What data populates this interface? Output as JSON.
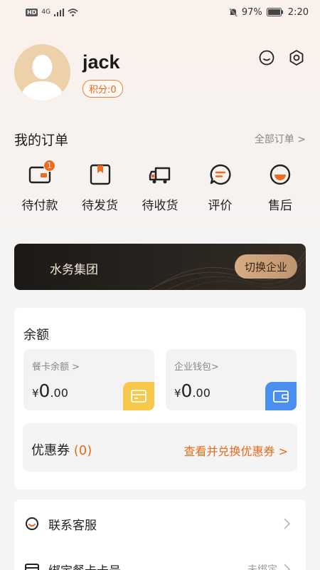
{
  "status_bar": {
    "network": "4G",
    "hd": "HD",
    "battery": "97%",
    "time": "2:20"
  },
  "profile": {
    "username": "jack",
    "points_label": "积分:0"
  },
  "orders": {
    "title": "我的订单",
    "all_link": "全部订单 >",
    "items": [
      {
        "label": "待付款",
        "badge": "1",
        "icon": "wallet-card-icon"
      },
      {
        "label": "待发货",
        "icon": "package-icon"
      },
      {
        "label": "待收货",
        "icon": "truck-icon"
      },
      {
        "label": "评价",
        "icon": "comment-icon"
      },
      {
        "label": "售后",
        "icon": "after-sale-icon"
      }
    ]
  },
  "company": {
    "name": "水务集团",
    "switch_label": "切换企业"
  },
  "balance": {
    "title": "余额",
    "meal_card": {
      "label": "餐卡余额 >",
      "symbol": "¥",
      "integer": "0",
      "decimal": ".00",
      "icon_color": "#f7c84a"
    },
    "enterprise_wallet": {
      "label": "企业钱包>",
      "symbol": "¥",
      "integer": "0",
      "decimal": ".00",
      "icon_color": "#4a8ef0"
    },
    "coupon": {
      "label": "优惠券",
      "count": "(0)",
      "link": "查看并兑换优惠券 >"
    }
  },
  "services": [
    {
      "label": "联系客服",
      "icon": "customer-service-icon"
    },
    {
      "label": "绑定餐卡卡号",
      "value": "未绑定",
      "icon": "card-icon"
    }
  ],
  "colors": {
    "accent": "#e86a1a",
    "badge": "#f06a1f",
    "avatar_bg": "#ecd1ab",
    "company_bg": "#1f1b17",
    "switch_btn": "#cfa57c"
  }
}
